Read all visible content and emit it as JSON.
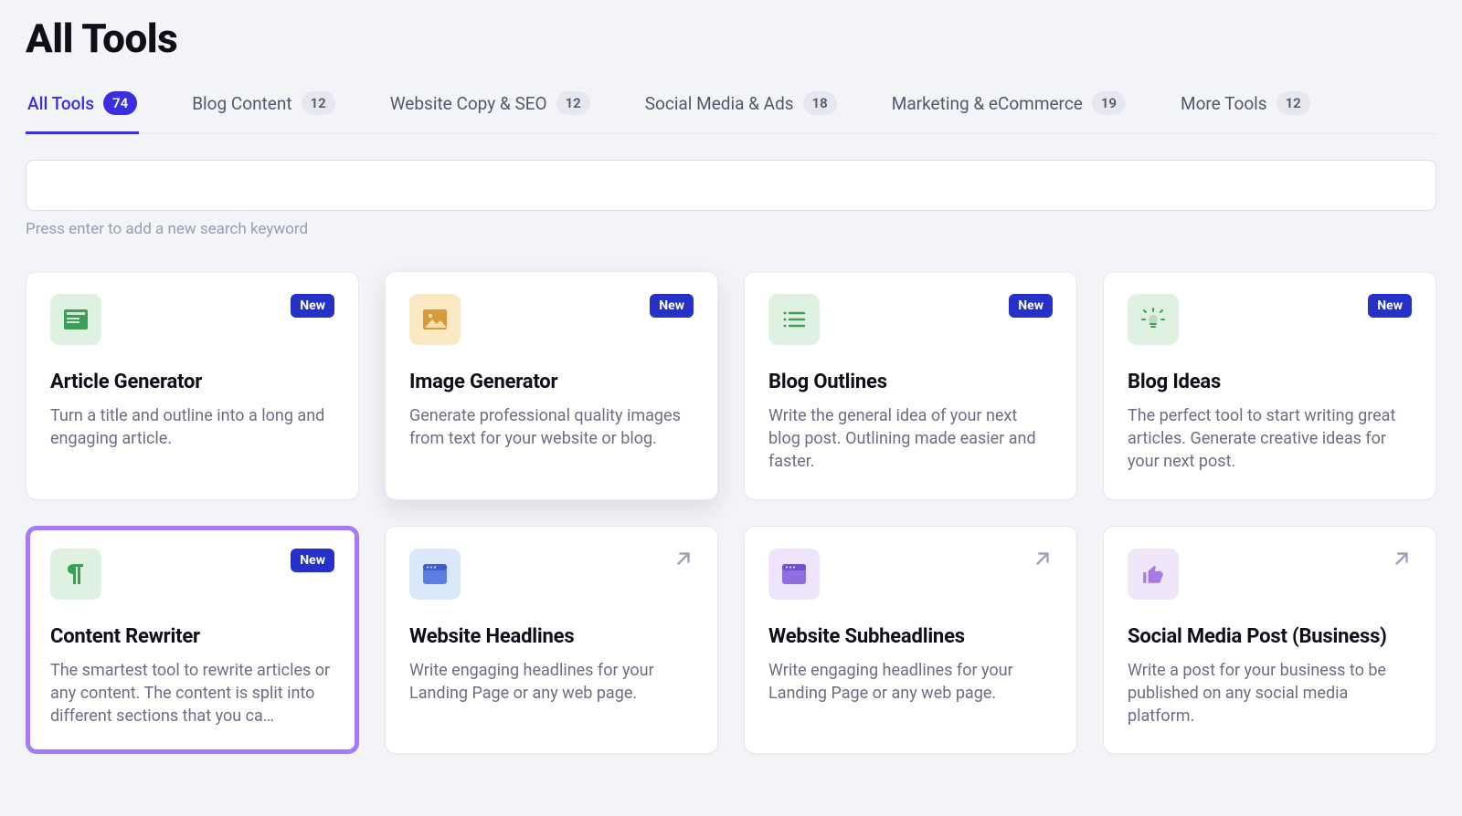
{
  "page": {
    "title": "All Tools"
  },
  "tabs": [
    {
      "label": "All Tools",
      "count": "74",
      "active": true
    },
    {
      "label": "Blog Content",
      "count": "12",
      "active": false
    },
    {
      "label": "Website Copy & SEO",
      "count": "12",
      "active": false
    },
    {
      "label": "Social Media & Ads",
      "count": "18",
      "active": false
    },
    {
      "label": "Marketing & eCommerce",
      "count": "19",
      "active": false
    },
    {
      "label": "More Tools",
      "count": "12",
      "active": false
    }
  ],
  "search": {
    "placeholder": "",
    "hint": "Press enter to add a new search keyword"
  },
  "badges": {
    "new": "New"
  },
  "tools": [
    {
      "title": "Article Generator",
      "desc": "Turn a title and outline into a long and engaging article.",
      "badge": "new",
      "icon": "article-icon",
      "tile": "bg-green"
    },
    {
      "title": "Image Generator",
      "desc": "Generate professional quality images from text for your website or blog.",
      "badge": "new",
      "icon": "image-icon",
      "tile": "bg-amber",
      "elevated": true
    },
    {
      "title": "Blog Outlines",
      "desc": "Write the general idea of your next blog post. Outlining made easier and faster.",
      "badge": "new",
      "icon": "list-icon",
      "tile": "bg-green"
    },
    {
      "title": "Blog Ideas",
      "desc": "The perfect tool to start writing great articles. Generate creative ideas for your next post.",
      "badge": "new",
      "icon": "idea-icon",
      "tile": "bg-green"
    },
    {
      "title": "Content Rewriter",
      "desc": "The smartest tool to rewrite articles or any content. The content is split into different sections that you ca…",
      "badge": "new",
      "icon": "paragraph-icon",
      "tile": "bg-green",
      "highlighted": true
    },
    {
      "title": "Website Headlines",
      "desc": "Write engaging headlines for your Landing Page or any web page.",
      "badge": "arrow",
      "icon": "browser-icon",
      "tile": "bg-blue"
    },
    {
      "title": "Website Subheadlines",
      "desc": "Write engaging headlines for your Landing Page or any web page.",
      "badge": "arrow",
      "icon": "browser-icon",
      "tile": "bg-violet"
    },
    {
      "title": "Social Media Post (Business)",
      "desc": "Write a post for your business to be published on any social media platform.",
      "badge": "arrow",
      "icon": "thumbs-up-icon",
      "tile": "bg-lilac"
    }
  ]
}
